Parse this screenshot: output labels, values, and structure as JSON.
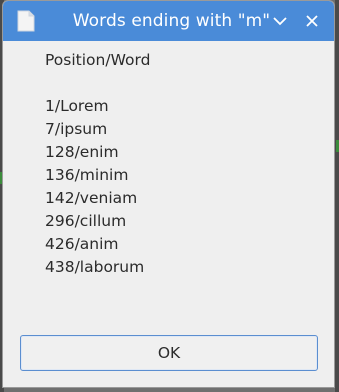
{
  "window": {
    "title": "Words ending with \"m\"",
    "icon": "document-icon",
    "minimize_icon": "chevron-down-icon",
    "close_icon": "close-icon"
  },
  "content": {
    "header": "Position/Word",
    "entries": [
      "1/Lorem",
      "7/ipsum",
      "128/enim",
      "136/minim",
      "142/veniam",
      "296/cillum",
      "426/anim",
      "438/laborum"
    ]
  },
  "buttons": {
    "ok_label": "OK"
  },
  "colors": {
    "titlebar": "#4a8bd8",
    "dialog_bg": "#efefef",
    "accent_border": "#5b8ed0"
  }
}
